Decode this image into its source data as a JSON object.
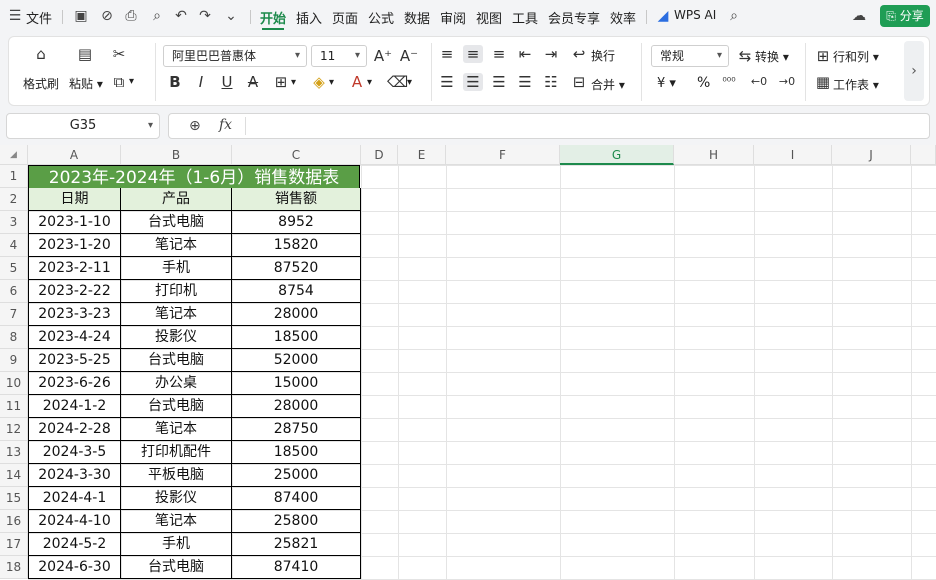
{
  "menubar": {
    "file_label": "文件",
    "tabs": [
      "开始",
      "插入",
      "页面",
      "公式",
      "数据",
      "审阅",
      "视图",
      "工具",
      "会员专享",
      "效率"
    ],
    "active_tab": "开始",
    "wps_ai_label": "WPS AI",
    "share_label": "分享"
  },
  "ribbon": {
    "format_painter": "格式刷",
    "paste": "粘贴",
    "font_name": "阿里巴巴普惠体",
    "font_size": "11",
    "wrap": "换行",
    "merge": "合并",
    "number_format": "常规",
    "convert": "转换",
    "row_col": "行和列",
    "worksheet": "工作表",
    "currency_symbol": "¥",
    "percent_symbol": "%"
  },
  "formula_bar": {
    "name_box": "G35",
    "formula": ""
  },
  "columns": [
    "A",
    "B",
    "C",
    "D",
    "E",
    "F",
    "G",
    "H",
    "I",
    "J"
  ],
  "selected_column": "G",
  "rows": [
    "1",
    "2",
    "3",
    "4",
    "5",
    "6",
    "7",
    "8",
    "9",
    "10",
    "11",
    "12",
    "13",
    "14",
    "15",
    "16",
    "17",
    "18"
  ],
  "sheet": {
    "title": "2023年-2024年（1-6月）销售数据表",
    "headers": [
      "日期",
      "产品",
      "销售额"
    ],
    "data": [
      [
        "2023-1-10",
        "台式电脑",
        "8952"
      ],
      [
        "2023-1-20",
        "笔记本",
        "15820"
      ],
      [
        "2023-2-11",
        "手机",
        "87520"
      ],
      [
        "2023-2-22",
        "打印机",
        "8754"
      ],
      [
        "2023-3-23",
        "笔记本",
        "28000"
      ],
      [
        "2023-4-24",
        "投影仪",
        "18500"
      ],
      [
        "2023-5-25",
        "台式电脑",
        "52000"
      ],
      [
        "2023-6-26",
        "办公桌",
        "15000"
      ],
      [
        "2024-1-2",
        "台式电脑",
        "28000"
      ],
      [
        "2024-2-28",
        "笔记本",
        "28750"
      ],
      [
        "2024-3-5",
        "打印机配件",
        "18500"
      ],
      [
        "2024-3-30",
        "平板电脑",
        "25000"
      ],
      [
        "2024-4-1",
        "投影仪",
        "87400"
      ],
      [
        "2024-4-10",
        "笔记本",
        "25800"
      ],
      [
        "2024-5-2",
        "手机",
        "25821"
      ],
      [
        "2024-6-30",
        "台式电脑",
        "87410"
      ]
    ]
  },
  "colors": {
    "accent": "#1d8a4c",
    "title_fill": "#5a9e46",
    "header_fill": "#e3f1dc"
  }
}
